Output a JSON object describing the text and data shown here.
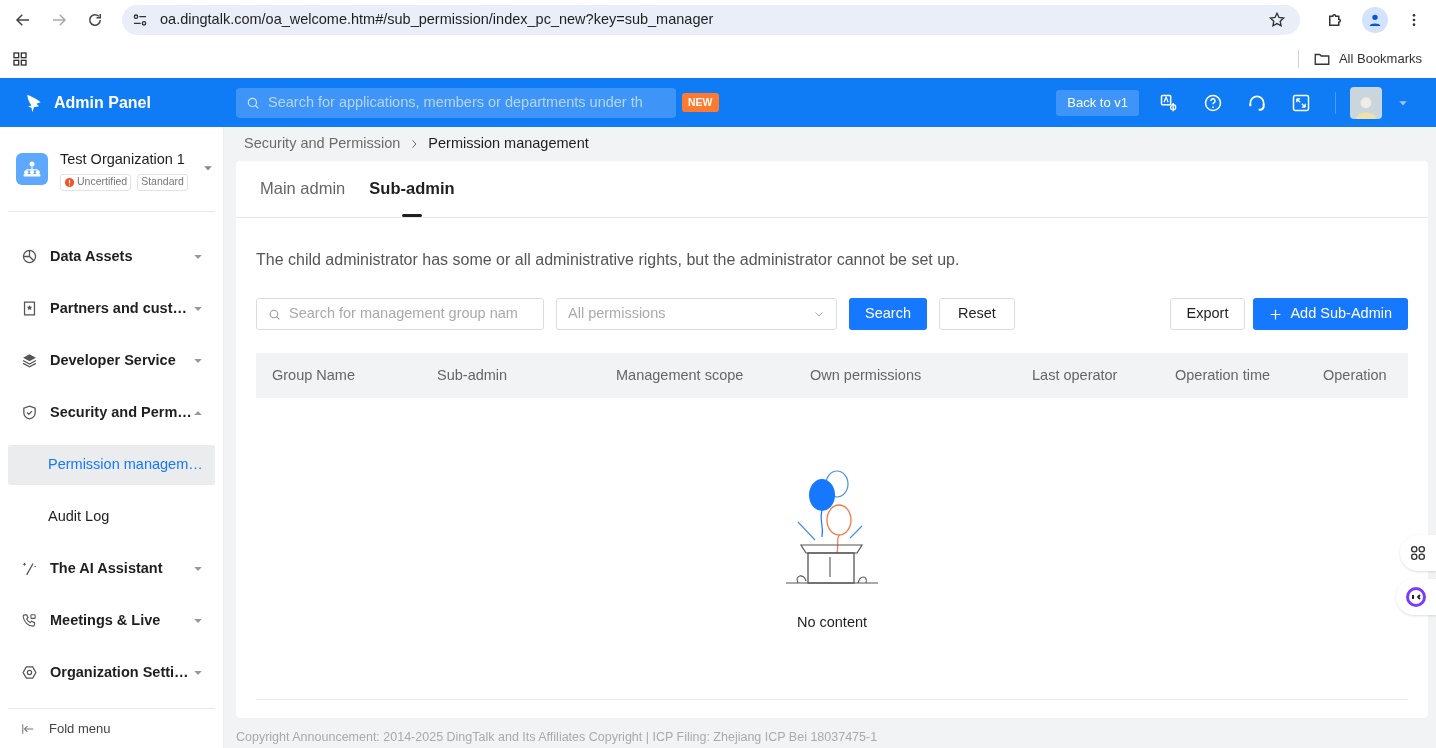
{
  "browser": {
    "url": "oa.dingtalk.com/oa_welcome.htm#/sub_permission/index_pc_new?key=sub_manager",
    "bookmarks": "All Bookmarks"
  },
  "header": {
    "title": "Admin Panel",
    "search_placeholder": "Search for applications, members or departments under th",
    "new_badge": "NEW",
    "back_button": "Back to v1"
  },
  "sidebar": {
    "org_name": "Test Organization 1",
    "badges": [
      {
        "label": "Uncertified",
        "kind": "warning"
      },
      {
        "label": "Standard",
        "kind": "plain"
      }
    ],
    "menu": [
      {
        "label": "Data Assets",
        "expanded": false
      },
      {
        "label": "Partners and cust…",
        "expanded": false
      },
      {
        "label": "Developer Service",
        "expanded": false
      },
      {
        "label": "Security and Perm…",
        "expanded": true,
        "children": [
          {
            "label": "Permission managem…",
            "selected": true
          },
          {
            "label": "Audit Log",
            "selected": false
          }
        ]
      },
      {
        "label": "The AI Assistant",
        "expanded": false
      },
      {
        "label": "Meetings & Live",
        "expanded": false
      },
      {
        "label": "Organization Setti…",
        "expanded": false
      }
    ],
    "fold_label": "Fold menu"
  },
  "breadcrumb": [
    "Security and Permission",
    "Permission management"
  ],
  "tabs": [
    {
      "label": "Main admin",
      "selected": false
    },
    {
      "label": "Sub-admin",
      "selected": true
    }
  ],
  "description": "The child administrator has some or all administrative rights, but the administrator cannot be set up.",
  "filters": {
    "search_placeholder": "Search for management group nam",
    "select_placeholder": "All permissions",
    "search_button": "Search",
    "reset_button": "Reset",
    "export_button": "Export",
    "add_button": "Add Sub-Admin"
  },
  "table": {
    "columns": [
      "Group Name",
      "Sub-admin",
      "Management scope",
      "Own permissions",
      "Last operator",
      "Operation time",
      "Operation"
    ],
    "empty_text": "No content"
  },
  "footer": "Copyright Announcement: 2014-2025 DingTalk and Its Affiliates Copyright | ICP Filing: Zhejiang ICP Bei 18037475-1"
}
